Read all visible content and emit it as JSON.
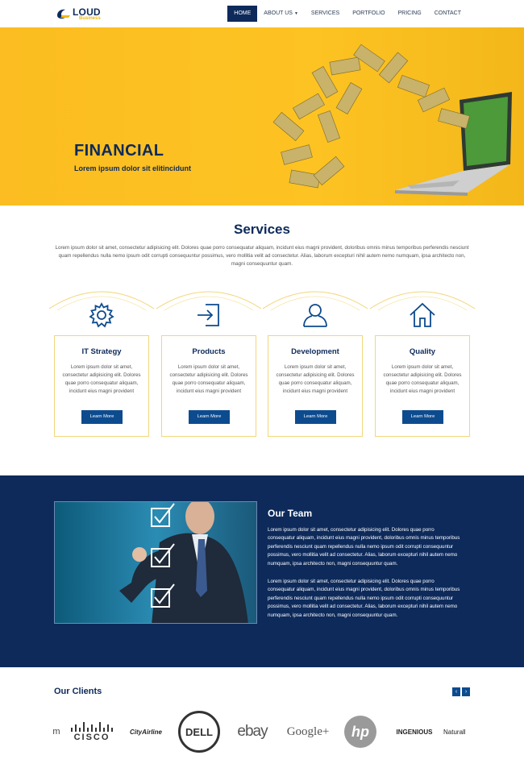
{
  "logo": {
    "main": "LOUD",
    "sub": "Business"
  },
  "nav": {
    "items": [
      {
        "label": "HOME",
        "active": true
      },
      {
        "label": "ABOUT US",
        "caret": true
      },
      {
        "label": "SERVICES"
      },
      {
        "label": "PORTFOLIO"
      },
      {
        "label": "PRICING"
      },
      {
        "label": "CONTACT"
      }
    ]
  },
  "hero": {
    "title": "FINANCIAL",
    "subtitle": "Lorem ipsum dolor sit elitincidunt"
  },
  "services": {
    "title": "Services",
    "intro": "Lorem ipsum dolor sit amet, consectetur adipisicing elit. Dolores quae porro consequatur aliquam, incidunt eius magni provident, doloribus omnis minus temporibus perferendis nesciunt quam repellendus nulla nemo ipsum odit corrupti consequuntur possimus, vero mollitia velit ad consectetur. Alias, laborum excepturi nihil autem nemo numquam, ipsa architecto non, magni consequuntur quam.",
    "items": [
      {
        "title": "IT Strategy",
        "text": "Lorem ipsum dolor sit amet, consectetur adipisicing elit. Dolores quae porro consequatur aliquam, incidunt eius magni provident",
        "button": "Learn More",
        "icon": "gear-icon"
      },
      {
        "title": "Products",
        "text": "Lorem ipsum dolor sit amet, consectetur adipisicing elit. Dolores quae porro consequatur aliquam, incidunt eius magni provident",
        "button": "Learn More",
        "icon": "sign-in-icon"
      },
      {
        "title": "Development",
        "text": "Lorem ipsum dolor sit amet, consectetur adipisicing elit. Dolores quae porro consequatur aliquam, incidunt eius magni provident",
        "button": "Learn More",
        "icon": "user-icon"
      },
      {
        "title": "Quality",
        "text": "Lorem ipsum dolor sit amet, consectetur adipisicing elit. Dolores quae porro consequatur aliquam, incidunt eius magni provident",
        "button": "Learn More",
        "icon": "home-icon"
      }
    ]
  },
  "team": {
    "title": "Our Team",
    "p1": "Lorem ipsum dolor sit amet, consectetur adipisicing elit. Dolores quae porro consequatur aliquam, incidunt eius magni provident, doloribus omnis minus temporibus perferendis nesciunt quam repellendus nulla nemo ipsum odit corrupti consequuntur possimus, vero mollitia velit ad consectetur. Alias, laborum excepturi nihil autem nemo numquam, ipsa architecto non, magni consequuntur quam.",
    "p2": "Lorem ipsum dolor sit amet, consectetur adipisicing elit. Dolores quae porro consequatur aliquam, incidunt eius magni provident, doloribus omnis minus temporibus perferendis nesciunt quam repellendus nulla nemo ipsum odit corrupti consequuntur possimus, vero mollitia velit ad consectetur. Alias, laborum excepturi nihil autem nemo numquam, ipsa architecto non, magni consequuntur quam."
  },
  "clients": {
    "title": "Our Clients",
    "prev": "‹",
    "next": "›",
    "logos": [
      "m",
      "CISCO",
      "CityAirline",
      "DELL",
      "ebay",
      "Google+",
      "hp",
      "INGENIOUS",
      "Naturall"
    ]
  },
  "colors": {
    "navy": "#0d2a5b",
    "yellow": "#fdc322",
    "button": "#0d4b8f",
    "card_border": "#f3d67a"
  }
}
